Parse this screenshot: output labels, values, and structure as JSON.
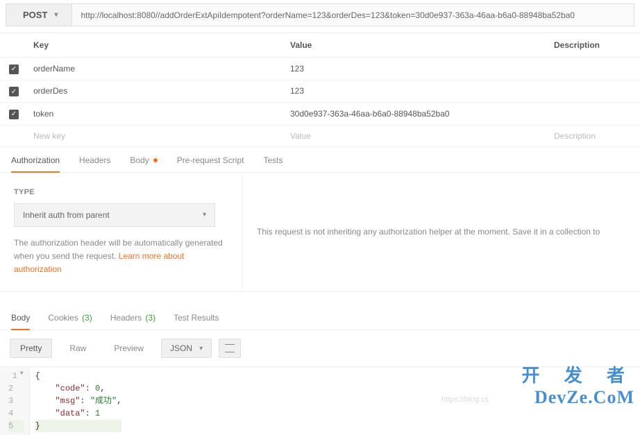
{
  "request": {
    "method": "POST",
    "url": "http://localhost:8080//addOrderExtApiIdempotent?orderName=123&orderDes=123&token=30d0e937-363a-46aa-b6a0-88948ba52ba0"
  },
  "params": {
    "headers": {
      "key": "Key",
      "value": "Value",
      "description": "Description"
    },
    "rows": [
      {
        "checked": true,
        "key": "orderName",
        "value": "123"
      },
      {
        "checked": true,
        "key": "orderDes",
        "value": "123"
      },
      {
        "checked": true,
        "key": "token",
        "value": "30d0e937-363a-46aa-b6a0-88948ba52ba0"
      }
    ],
    "placeholder": {
      "key": "New key",
      "value": "Value",
      "description": "Description"
    }
  },
  "requestTabs": {
    "authorization": "Authorization",
    "headers": "Headers",
    "body": "Body",
    "preRequest": "Pre-request Script",
    "tests": "Tests"
  },
  "auth": {
    "typeLabel": "TYPE",
    "selected": "Inherit auth from parent",
    "descPart1": "The authorization header will be automatically generated when you send the request. ",
    "learnMore": "Learn more about authorization",
    "rightMessage": "This request is not inheriting any authorization helper at the moment. Save it in a collection to"
  },
  "responseTabs": {
    "body": "Body",
    "cookies": "Cookies",
    "cookiesCount": "(3)",
    "headers": "Headers",
    "headersCount": "(3)",
    "testResults": "Test Results"
  },
  "responseControls": {
    "pretty": "Pretty",
    "raw": "Raw",
    "preview": "Preview",
    "format": "JSON"
  },
  "responseBody": {
    "code": 0,
    "msg": "成功",
    "data": 1
  },
  "codeLines": {
    "l1": "{",
    "l2a": "    \"code\"",
    "l2b": ": ",
    "l2c": "0",
    "l2d": ",",
    "l3a": "    \"msg\"",
    "l3b": ": ",
    "l3c": "\"成功\"",
    "l3d": ",",
    "l4a": "    \"data\"",
    "l4b": ": ",
    "l4c": "1",
    "l5": "}"
  },
  "watermark": {
    "cn": "开 发 者",
    "en": "DevZe.CoM",
    "url": "https://blog.cs"
  }
}
